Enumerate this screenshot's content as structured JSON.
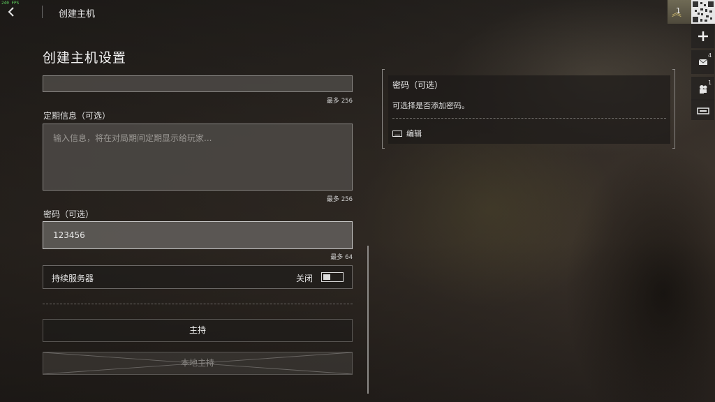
{
  "debug": {
    "fps_text": "240 FPS"
  },
  "header": {
    "title": "创建主机"
  },
  "page": {
    "heading": "创建主机设置"
  },
  "form": {
    "top_field": {
      "counter_prefix": "最多",
      "counter_value": "256"
    },
    "message": {
      "label": "定期信息（可选）",
      "placeholder": "输入信息，将在对局期间定期显示给玩家...",
      "counter_prefix": "最多",
      "counter_value": "256"
    },
    "password": {
      "label": "密码（可选）",
      "value": "123456",
      "counter_prefix": "最多",
      "counter_value": "64"
    },
    "persistent_server": {
      "label": "持续服务器",
      "state_label": "关闭",
      "enabled": false
    },
    "host_button": "主持",
    "local_host_button": "本地主持"
  },
  "info_panel": {
    "title": "密码（可选）",
    "description": "可选择是否添加密码。",
    "edit_label": "编辑"
  },
  "right_rail": {
    "rank_number": "1",
    "buttons": [
      {
        "icon": "plus-icon"
      },
      {
        "icon": "mail-icon",
        "badge": "4"
      },
      {
        "icon": "party-icon",
        "badge": "1"
      },
      {
        "icon": "keyboard-icon"
      }
    ]
  }
}
